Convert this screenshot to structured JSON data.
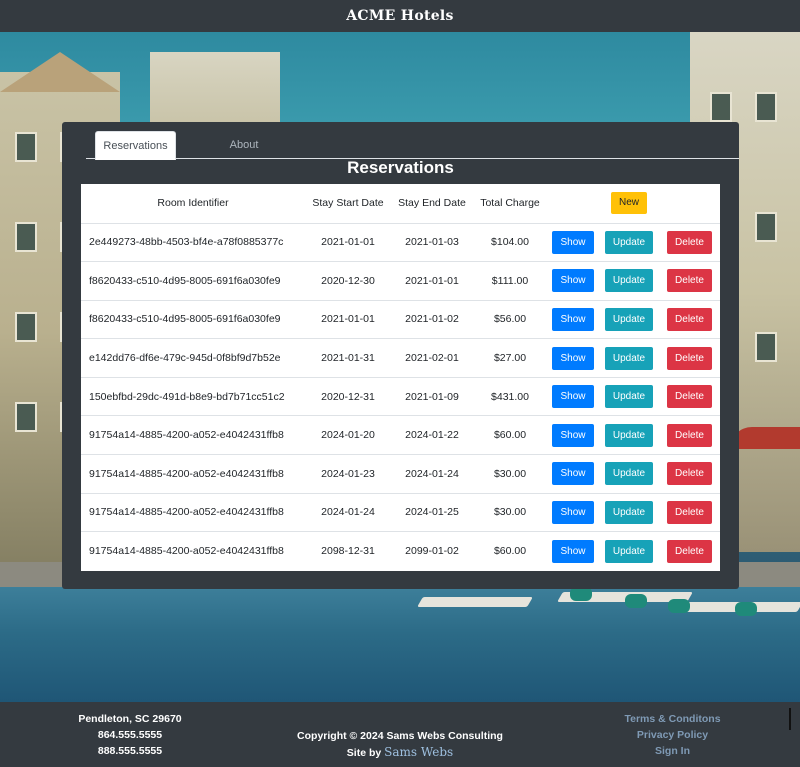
{
  "header": {
    "brand": "ACME Hotels"
  },
  "tabs": [
    {
      "label": "Reservations",
      "active": true
    },
    {
      "label": "About",
      "active": false
    }
  ],
  "page_title": "Reservations",
  "table": {
    "headers": [
      "Room Identifier",
      "Stay Start Date",
      "Stay End Date",
      "Total Charge"
    ],
    "new_label": "New",
    "show_label": "Show",
    "update_label": "Update",
    "delete_label": "Delete",
    "rows": [
      {
        "room": "2e449273-48bb-4503-bf4e-a78f0885377c",
        "start": "2021-01-01",
        "end": "2021-01-03",
        "charge": "$104.00"
      },
      {
        "room": "f8620433-c510-4d95-8005-691f6a030fe9",
        "start": "2020-12-30",
        "end": "2021-01-01",
        "charge": "$111.00"
      },
      {
        "room": "f8620433-c510-4d95-8005-691f6a030fe9",
        "start": "2021-01-01",
        "end": "2021-01-02",
        "charge": "$56.00"
      },
      {
        "room": "e142dd76-df6e-479c-945d-0f8bf9d7b52e",
        "start": "2021-01-31",
        "end": "2021-02-01",
        "charge": "$27.00"
      },
      {
        "room": "150ebfbd-29dc-491d-b8e9-bd7b71cc51c2",
        "start": "2020-12-31",
        "end": "2021-01-09",
        "charge": "$431.00"
      },
      {
        "room": "91754a14-4885-4200-a052-e4042431ffb8",
        "start": "2024-01-20",
        "end": "2024-01-22",
        "charge": "$60.00"
      },
      {
        "room": "91754a14-4885-4200-a052-e4042431ffb8",
        "start": "2024-01-23",
        "end": "2024-01-24",
        "charge": "$30.00"
      },
      {
        "room": "91754a14-4885-4200-a052-e4042431ffb8",
        "start": "2024-01-24",
        "end": "2024-01-25",
        "charge": "$30.00"
      },
      {
        "room": "91754a14-4885-4200-a052-e4042431ffb8",
        "start": "2098-12-31",
        "end": "2099-01-02",
        "charge": "$60.00"
      }
    ]
  },
  "footer": {
    "address": "Pendleton, SC 29670",
    "phone1": "864.555.5555",
    "phone2": "888.555.5555",
    "copyright": "Copyright © 2024 Sams Webs Consulting",
    "site_by_prefix": "Site by",
    "site_by_name": "Sams Webs",
    "links": [
      "Terms & Conditons",
      "Privacy Policy",
      "Sign In"
    ]
  },
  "colors": {
    "navbar": "#343a40",
    "show": "#007bff",
    "update": "#17a2b8",
    "delete": "#dc3545",
    "new": "#ffc107"
  }
}
